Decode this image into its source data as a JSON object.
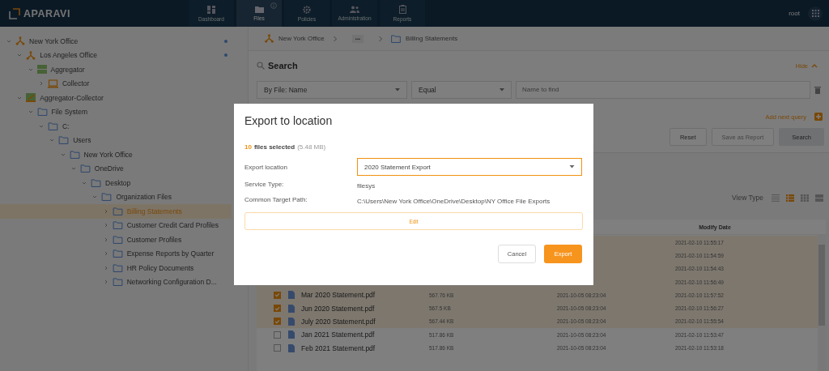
{
  "header": {
    "logo": "APARAVI",
    "nav": [
      {
        "label": "Dashboard",
        "selected": false,
        "info": false
      },
      {
        "label": "Files",
        "selected": true,
        "info": true
      },
      {
        "label": "Policies",
        "selected": false,
        "info": false
      },
      {
        "label": "Administration",
        "selected": false,
        "info": false
      },
      {
        "label": "Reports",
        "selected": false,
        "info": false
      }
    ],
    "user": "root"
  },
  "tree": [
    {
      "label": "New York Office",
      "kind": "node",
      "expanded": true,
      "selected": false,
      "online": true,
      "children": [
        {
          "label": "Los Angeles Office",
          "kind": "node",
          "expanded": true,
          "selected": false,
          "online": true,
          "children": [
            {
              "label": "Aggregator",
              "kind": "aggregator",
              "expanded": true,
              "selected": false,
              "online": false,
              "children": [
                {
                  "label": "Collector",
                  "kind": "collector",
                  "expanded": false,
                  "selected": false,
                  "online": false
                }
              ]
            }
          ]
        },
        {
          "label": "Aggregator-Collector",
          "kind": "hybrid",
          "expanded": true,
          "selected": false,
          "online": false,
          "children": [
            {
              "label": "File System",
              "kind": "folder",
              "expanded": true,
              "selected": false,
              "online": false,
              "children": [
                {
                  "label": "C:",
                  "kind": "folder",
                  "expanded": true,
                  "selected": false,
                  "online": false,
                  "children": [
                    {
                      "label": "Users",
                      "kind": "folder",
                      "expanded": true,
                      "selected": false,
                      "online": false,
                      "children": [
                        {
                          "label": "New York Office",
                          "kind": "folder",
                          "expanded": true,
                          "selected": false,
                          "online": false,
                          "children": [
                            {
                              "label": "OneDrive",
                              "kind": "folder",
                              "expanded": true,
                              "selected": false,
                              "online": false,
                              "children": [
                                {
                                  "label": "Desktop",
                                  "kind": "folder",
                                  "expanded": true,
                                  "selected": false,
                                  "online": false,
                                  "children": [
                                    {
                                      "label": "Organization Files",
                                      "kind": "folder",
                                      "expanded": true,
                                      "selected": false,
                                      "online": false,
                                      "children": [
                                        {
                                          "label": "Billing Statements",
                                          "kind": "folder",
                                          "expanded": false,
                                          "selected": true,
                                          "online": false
                                        },
                                        {
                                          "label": "Customer Credit Card Profiles",
                                          "kind": "folder",
                                          "expanded": false,
                                          "selected": false,
                                          "online": false
                                        },
                                        {
                                          "label": "Customer Profiles",
                                          "kind": "folder",
                                          "expanded": false,
                                          "selected": false,
                                          "online": false
                                        },
                                        {
                                          "label": "Expense Reports by Quarter",
                                          "kind": "folder",
                                          "expanded": false,
                                          "selected": false,
                                          "online": false
                                        },
                                        {
                                          "label": "HR Policy Documents",
                                          "kind": "folder",
                                          "expanded": false,
                                          "selected": false,
                                          "online": false
                                        },
                                        {
                                          "label": "Networking Configuration D...",
                                          "kind": "folder",
                                          "expanded": false,
                                          "selected": false,
                                          "online": false
                                        }
                                      ]
                                    }
                                  ]
                                }
                              ]
                            }
                          ]
                        }
                      ]
                    }
                  ]
                }
              ]
            }
          ]
        }
      ]
    }
  ],
  "breadcrumb": {
    "root": "New York Office",
    "more": "•••",
    "current": "Billing Statements"
  },
  "search": {
    "title": "Search",
    "hide": "Hide",
    "field": "By File: Name",
    "operator": "Equal",
    "placeholder": "Name to find",
    "add_query": "Add next query",
    "buttons": [
      {
        "label": "Reset",
        "kind": "plain",
        "disabled": false
      },
      {
        "label": "Save as Report",
        "kind": "plain",
        "disabled": true
      },
      {
        "label": "Search",
        "kind": "primary",
        "disabled": false
      }
    ]
  },
  "view_type": {
    "label": "View Type",
    "options": [
      {
        "selected": false
      },
      {
        "selected": true
      },
      {
        "selected": false
      },
      {
        "selected": false
      }
    ]
  },
  "table": {
    "columns": [
      "Modify Date"
    ],
    "rows": [
      {
        "selected": true,
        "modify_date": "2021-02-10 11:55:17"
      },
      {
        "selected": true,
        "modify_date": "2021-02-10 11:54:59"
      },
      {
        "selected": true,
        "modify_date": "2021-02-10 11:54:43"
      },
      {
        "selected": true,
        "modify_date": "2021-02-10 11:56:49"
      },
      {
        "selected": true,
        "name": "Mar 2020 Statement.pdf",
        "size": "567.76 KB",
        "create_date": "2021-10-05 08:23:04",
        "modify_date": "2021-02-10 11:57:52"
      },
      {
        "selected": true,
        "name": "Jun 2020 Statement.pdf",
        "size": "567.5 KB",
        "create_date": "2021-10-05 08:23:04",
        "modify_date": "2021-02-10 11:56:27"
      },
      {
        "selected": true,
        "name": "July 2020 Statement.pdf",
        "size": "567.44 KB",
        "create_date": "2021-10-05 08:23:04",
        "modify_date": "2021-02-10 11:55:54"
      },
      {
        "selected": false,
        "name": "Jan 2021 Statement.pdf",
        "size": "517.86 KB",
        "create_date": "2021-10-05 08:23:04",
        "modify_date": "2021-02-10 11:53:47"
      },
      {
        "selected": false,
        "name": "Feb 2021 Statement.pdf",
        "size": "517.86 KB",
        "create_date": "2021-10-05 08:23:04",
        "modify_date": "2021-02-10 11:53:18"
      }
    ]
  },
  "dialog": {
    "title": "Export to location",
    "count": "10",
    "count_label": "files selected",
    "size": "(5.48 MB)",
    "location_label": "Export location",
    "location": "2020 Statement Export",
    "service_label": "Service Type:",
    "service": "filesys",
    "path_label": "Common Target Path:",
    "path": "C:\\Users\\New York Office\\OneDrive\\Desktop\\NY Office File Exports",
    "edit": "Edit",
    "cancel": "Cancel",
    "export": "Export"
  }
}
